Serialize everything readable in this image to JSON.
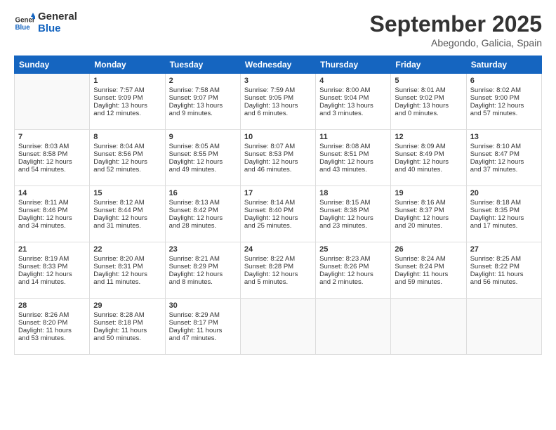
{
  "logo": {
    "line1": "General",
    "line2": "Blue"
  },
  "title": "September 2025",
  "location": "Abegondo, Galicia, Spain",
  "days_of_week": [
    "Sunday",
    "Monday",
    "Tuesday",
    "Wednesday",
    "Thursday",
    "Friday",
    "Saturday"
  ],
  "weeks": [
    [
      {
        "day": "",
        "info": ""
      },
      {
        "day": "1",
        "info": "Sunrise: 7:57 AM\nSunset: 9:09 PM\nDaylight: 13 hours\nand 12 minutes."
      },
      {
        "day": "2",
        "info": "Sunrise: 7:58 AM\nSunset: 9:07 PM\nDaylight: 13 hours\nand 9 minutes."
      },
      {
        "day": "3",
        "info": "Sunrise: 7:59 AM\nSunset: 9:05 PM\nDaylight: 13 hours\nand 6 minutes."
      },
      {
        "day": "4",
        "info": "Sunrise: 8:00 AM\nSunset: 9:04 PM\nDaylight: 13 hours\nand 3 minutes."
      },
      {
        "day": "5",
        "info": "Sunrise: 8:01 AM\nSunset: 9:02 PM\nDaylight: 13 hours\nand 0 minutes."
      },
      {
        "day": "6",
        "info": "Sunrise: 8:02 AM\nSunset: 9:00 PM\nDaylight: 12 hours\nand 57 minutes."
      }
    ],
    [
      {
        "day": "7",
        "info": "Sunrise: 8:03 AM\nSunset: 8:58 PM\nDaylight: 12 hours\nand 54 minutes."
      },
      {
        "day": "8",
        "info": "Sunrise: 8:04 AM\nSunset: 8:56 PM\nDaylight: 12 hours\nand 52 minutes."
      },
      {
        "day": "9",
        "info": "Sunrise: 8:05 AM\nSunset: 8:55 PM\nDaylight: 12 hours\nand 49 minutes."
      },
      {
        "day": "10",
        "info": "Sunrise: 8:07 AM\nSunset: 8:53 PM\nDaylight: 12 hours\nand 46 minutes."
      },
      {
        "day": "11",
        "info": "Sunrise: 8:08 AM\nSunset: 8:51 PM\nDaylight: 12 hours\nand 43 minutes."
      },
      {
        "day": "12",
        "info": "Sunrise: 8:09 AM\nSunset: 8:49 PM\nDaylight: 12 hours\nand 40 minutes."
      },
      {
        "day": "13",
        "info": "Sunrise: 8:10 AM\nSunset: 8:47 PM\nDaylight: 12 hours\nand 37 minutes."
      }
    ],
    [
      {
        "day": "14",
        "info": "Sunrise: 8:11 AM\nSunset: 8:46 PM\nDaylight: 12 hours\nand 34 minutes."
      },
      {
        "day": "15",
        "info": "Sunrise: 8:12 AM\nSunset: 8:44 PM\nDaylight: 12 hours\nand 31 minutes."
      },
      {
        "day": "16",
        "info": "Sunrise: 8:13 AM\nSunset: 8:42 PM\nDaylight: 12 hours\nand 28 minutes."
      },
      {
        "day": "17",
        "info": "Sunrise: 8:14 AM\nSunset: 8:40 PM\nDaylight: 12 hours\nand 25 minutes."
      },
      {
        "day": "18",
        "info": "Sunrise: 8:15 AM\nSunset: 8:38 PM\nDaylight: 12 hours\nand 23 minutes."
      },
      {
        "day": "19",
        "info": "Sunrise: 8:16 AM\nSunset: 8:37 PM\nDaylight: 12 hours\nand 20 minutes."
      },
      {
        "day": "20",
        "info": "Sunrise: 8:18 AM\nSunset: 8:35 PM\nDaylight: 12 hours\nand 17 minutes."
      }
    ],
    [
      {
        "day": "21",
        "info": "Sunrise: 8:19 AM\nSunset: 8:33 PM\nDaylight: 12 hours\nand 14 minutes."
      },
      {
        "day": "22",
        "info": "Sunrise: 8:20 AM\nSunset: 8:31 PM\nDaylight: 12 hours\nand 11 minutes."
      },
      {
        "day": "23",
        "info": "Sunrise: 8:21 AM\nSunset: 8:29 PM\nDaylight: 12 hours\nand 8 minutes."
      },
      {
        "day": "24",
        "info": "Sunrise: 8:22 AM\nSunset: 8:28 PM\nDaylight: 12 hours\nand 5 minutes."
      },
      {
        "day": "25",
        "info": "Sunrise: 8:23 AM\nSunset: 8:26 PM\nDaylight: 12 hours\nand 2 minutes."
      },
      {
        "day": "26",
        "info": "Sunrise: 8:24 AM\nSunset: 8:24 PM\nDaylight: 11 hours\nand 59 minutes."
      },
      {
        "day": "27",
        "info": "Sunrise: 8:25 AM\nSunset: 8:22 PM\nDaylight: 11 hours\nand 56 minutes."
      }
    ],
    [
      {
        "day": "28",
        "info": "Sunrise: 8:26 AM\nSunset: 8:20 PM\nDaylight: 11 hours\nand 53 minutes."
      },
      {
        "day": "29",
        "info": "Sunrise: 8:28 AM\nSunset: 8:18 PM\nDaylight: 11 hours\nand 50 minutes."
      },
      {
        "day": "30",
        "info": "Sunrise: 8:29 AM\nSunset: 8:17 PM\nDaylight: 11 hours\nand 47 minutes."
      },
      {
        "day": "",
        "info": ""
      },
      {
        "day": "",
        "info": ""
      },
      {
        "day": "",
        "info": ""
      },
      {
        "day": "",
        "info": ""
      }
    ]
  ]
}
